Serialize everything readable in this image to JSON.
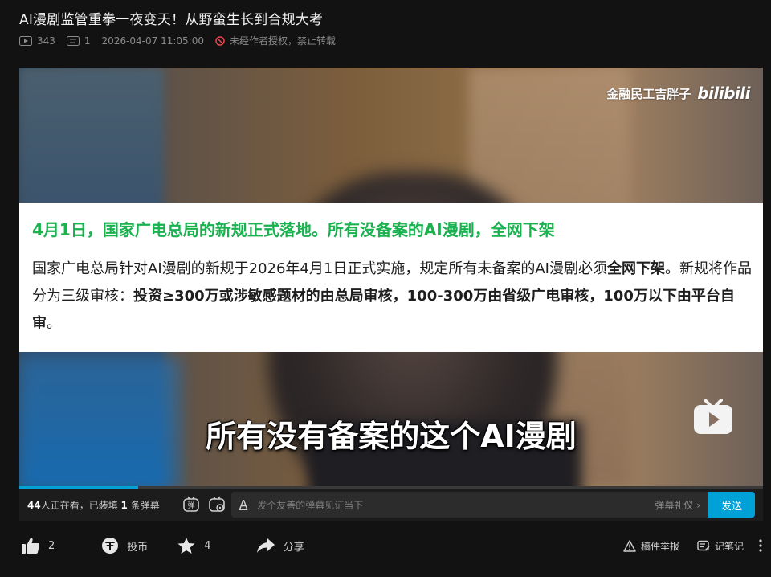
{
  "video": {
    "title": "AI漫剧监管重拳一夜变天！从野蛮生长到合规大考",
    "views": "343",
    "danmaku_count": "1",
    "datetime": "2026-04-07 11:05:00",
    "notice": "未经作者授权，禁止转载"
  },
  "frame": {
    "watermark_author": "金融民工吉胖子",
    "watermark_brand": "bilibili",
    "headline": "4月1日，国家广电总局的新规正式落地。所有没备案的AI漫剧，全网下架",
    "body_part1": "国家广电总局针对AI漫剧的新规于2026年4月1日正式实施，规定所有未备案的AI漫剧必须",
    "body_bold1": "全网下架",
    "body_part2": "。新规将作品分为三级审核：",
    "body_bold2": "投资≥300万或涉敏感题材的由总局审核，100-300万由省级广电审核，100万以下由平台自审",
    "body_part3": "。",
    "subtitle": "所有没有备案的这个AI漫剧"
  },
  "player": {
    "progress_fraction": 0.16,
    "watching_count": "44",
    "watching_text_1": "人正在看，已装填 ",
    "watching_loaded": "1",
    "watching_text_2": " 条弹幕",
    "danmaku_placeholder": "发个友善的弹幕见证当下",
    "danmaku_etiquette": "弹幕礼仪 ›",
    "send_label": "发送",
    "font_toggle_label": "A"
  },
  "actions": {
    "like_count": "2",
    "coin_label": "投币",
    "favorite_count": "4",
    "share_label": "分享",
    "report_label": "稿件举报",
    "notes_label": "记笔记"
  },
  "colors": {
    "accent": "#00a1d6",
    "headline_green": "#19b24f"
  }
}
